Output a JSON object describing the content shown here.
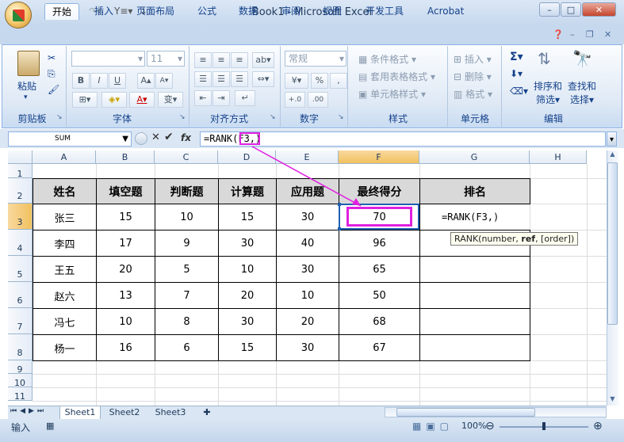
{
  "window": {
    "title": "Book1 - Microsoft Excel"
  },
  "quick_access": [
    "save",
    "undo",
    "redo",
    "format",
    "customize"
  ],
  "tabs": [
    "开始",
    "插入",
    "页面布局",
    "公式",
    "数据",
    "审阅",
    "视图",
    "开发工具",
    "Acrobat"
  ],
  "active_tab": "开始",
  "ribbon": {
    "clipboard": {
      "paste": "粘贴",
      "label": "剪贴板"
    },
    "font": {
      "size": "11",
      "label": "字体",
      "bold": "B",
      "italic": "I",
      "underline": "U",
      "wen": "变"
    },
    "alignment": {
      "label": "对齐方式"
    },
    "number": {
      "format": "常规",
      "label": "数字",
      "percent": "%",
      "comma": ","
    },
    "styles": {
      "conditional": "条件格式",
      "table": "套用表格格式",
      "cell": "单元格样式",
      "label": "样式"
    },
    "cells": {
      "insert": "插入",
      "delete": "删除",
      "format": "格式",
      "label": "单元格"
    },
    "editing": {
      "sort": "排序和",
      "sort2": "筛选",
      "find": "查找和",
      "find2": "选择",
      "label": "编辑"
    }
  },
  "formula_bar": {
    "name_box": "SUM",
    "fx": "fx",
    "formula": "=RANK(F3,)"
  },
  "columns": [
    "A",
    "B",
    "C",
    "D",
    "E",
    "F",
    "G",
    "H"
  ],
  "rows": [
    "1",
    "2",
    "3",
    "4",
    "5",
    "6",
    "7",
    "8",
    "9",
    "10",
    "11"
  ],
  "table": {
    "headers": [
      "姓名",
      "填空题",
      "判断题",
      "计算题",
      "应用题",
      "最终得分",
      "排名"
    ],
    "rows": [
      [
        "张三",
        "15",
        "10",
        "15",
        "30",
        "70",
        "=RANK(F3,)"
      ],
      [
        "李四",
        "17",
        "9",
        "30",
        "40",
        "96",
        ""
      ],
      [
        "王五",
        "20",
        "5",
        "10",
        "30",
        "65",
        ""
      ],
      [
        "赵六",
        "13",
        "7",
        "20",
        "10",
        "50",
        ""
      ],
      [
        "冯七",
        "10",
        "8",
        "30",
        "20",
        "68",
        ""
      ],
      [
        "杨一",
        "16",
        "6",
        "15",
        "30",
        "67",
        ""
      ]
    ]
  },
  "tooltip": {
    "prefix": "RANK(number, ",
    "bold": "ref",
    "suffix": ", [order])"
  },
  "sheets": [
    "Sheet1",
    "Sheet2",
    "Sheet3"
  ],
  "status": {
    "mode": "输入",
    "zoom": "100%"
  },
  "colors": {
    "arrow": "#e020e0",
    "highlight": "#e020e0"
  }
}
